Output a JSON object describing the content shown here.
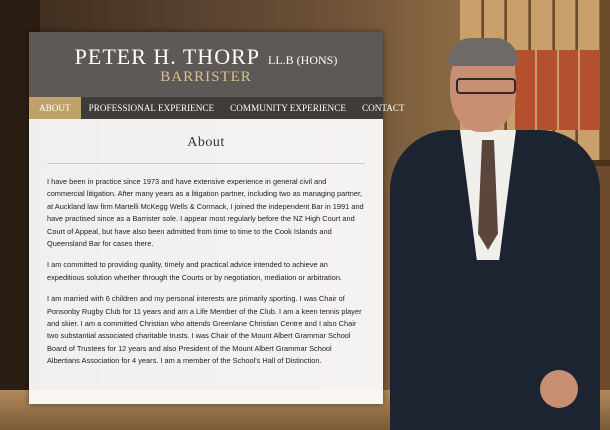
{
  "header": {
    "name": "PETER H. THORP",
    "credentials": "LL.B (HONS)",
    "role": "BARRISTER"
  },
  "nav": {
    "items": [
      {
        "label": "ABOUT",
        "active": true
      },
      {
        "label": "PROFESSIONAL EXPERIENCE",
        "active": false
      },
      {
        "label": "COMMUNITY EXPERIENCE",
        "active": false
      },
      {
        "label": "CONTACT",
        "active": false
      }
    ]
  },
  "page": {
    "heading": "About",
    "paragraphs": [
      "I have been in practice since 1973 and have extensive experience in general civil and commercial litigation. After many years as a litigation partner, including two as managing partner, at Auckland law firm Martelli McKegg Wells & Cormack, I joined the independent Bar in 1991 and have practised since as a Barrister sole. I appear most regularly before the NZ High Court and Court of Appeal, but have also been admitted from time to time to the Cook Islands and Queensland Bar for cases there.",
      "I am committed to providing quality, timely and practical advice intended to achieve an expeditious solution whether through the Courts or by negotiation, mediation or arbitration.",
      "I am married with 6 children and my personal interests are primarily sporting. I was Chair of Ponsonby Rugby Club for 11 years and am a Life Member of the Club. I am a keen tennis player and skier. I am a committed Christian who attends Greenlane Christian Centre and I also Chair two substantial associated charitable trusts. I was Chair of the Mount Albert Grammar School Board of Trustees for 12 years and also President of the Mount Albert Grammar School Albertians Association for 4 years. I am a member of the School's Hall of Distinction."
    ]
  },
  "colors": {
    "header_bg": "#5d5956",
    "nav_bg": "#3e3b39",
    "nav_active": "#bfa26a",
    "accent_gold": "#d8c28f"
  }
}
